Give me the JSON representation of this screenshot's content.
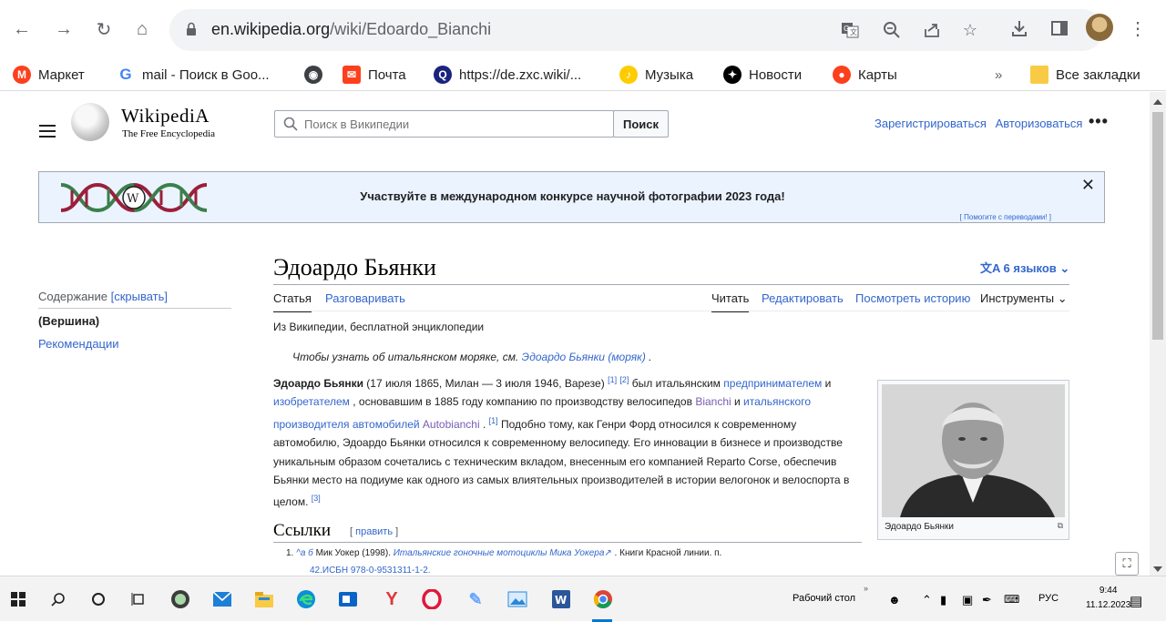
{
  "browser": {
    "url_domain": "en.wikipedia.org",
    "url_path": "/wiki/Edoardo_Bianchi"
  },
  "bookmarks": {
    "items": [
      {
        "label": "Маркет",
        "icon": "yandex-market-icon",
        "color": "#fc3f1d"
      },
      {
        "label": "mail - Поиск в Goo...",
        "icon": "google-icon",
        "color": "#4285f4"
      },
      {
        "label": "",
        "icon": "globe-icon",
        "color": "#3c4043"
      },
      {
        "label": "Почта",
        "icon": "mail-icon",
        "color": "#fc3f1d"
      },
      {
        "label": "https://de.zxc.wiki/...",
        "icon": "zxc-wiki-icon",
        "color": "#1a237e"
      },
      {
        "label": "Музыка",
        "icon": "music-icon",
        "color": "#ffcc00"
      },
      {
        "label": "Новости",
        "icon": "news-icon",
        "color": "#000000"
      },
      {
        "label": "Карты",
        "icon": "maps-icon",
        "color": "#fc3f1d"
      }
    ],
    "overflow": "»",
    "all_bookmarks": "Все закладки"
  },
  "wiki_header": {
    "wordmark": "WikipediA",
    "tagline": "The Free Encyclopedia",
    "search_placeholder": "Поиск в Википедии",
    "search_button": "Поиск",
    "register": "Зарегистрироваться",
    "login": "Авторизоваться",
    "more": "•••"
  },
  "banner": {
    "text": "Участвуйте в международном конкурсе научной фотографии 2023 года!",
    "help_link": "[ Помогите с переводами! ]",
    "close": "✕"
  },
  "toc": {
    "title": "Содержание",
    "toggle": "[скрывать]",
    "items": [
      "(Вершина)",
      "Рекомендации"
    ]
  },
  "article": {
    "title": "Эдоардо Бьянки",
    "languages": "6 языков",
    "tabs": {
      "article": "Статья",
      "talk": "Разговаривать",
      "read": "Читать",
      "edit": "Редактировать",
      "history": "Посмотреть историю",
      "tools": "Инструменты"
    },
    "from_wikipedia": "Из Википедии, бесплатной энциклопедии",
    "hatnote_prefix": "Чтобы узнать об итальянском моряке, см.",
    "hatnote_link": "Эдоардо Бьянки (моряк)",
    "hatnote_suffix": ".",
    "body": {
      "name_bold": "Эдоардо Бьянки",
      "t1": " (17 июля 1865, Милан — 3 июля 1946, Варезе) ",
      "sup1": "[1]",
      "sup2": "[2]",
      "t2": " был итальянским ",
      "link_entrepreneur": "предпринимателем",
      "t3": " и ",
      "link_inventor": "изобретателем",
      "t4": " , основавшим в 1885 году компанию по производству велосипедов ",
      "link_bianchi": "Bianchi",
      "t5": " и ",
      "link_italian": "итальянского производителя автомобилей",
      "t6": " ",
      "link_autobianchi": "Autobianchi",
      "t7": " . ",
      "sup3": "[1]",
      "t8": " Подобно тому, как Генри Форд относился к современному автомобилю, Эдоардо Бьянки относился к современному велосипеду. Его инновации в бизнесе и производстве уникальным образом сочетались с техническим вкладом, внесенным его компанией Reparto Corse, обеспечив Бьянки место на подиуме как одного из самых влиятельных производителей в истории велогонок и велоспорта в целом. ",
      "sup4": "[3]"
    },
    "infobox_caption": "Эдоардо Бьянки",
    "references_title": "Ссылки",
    "references_edit_open": "[",
    "references_edit": "править",
    "references_edit_close": "]",
    "ref1_num": "1.",
    "ref1_marks": "^а б",
    "ref1_author": "Мик Уокер (1998).",
    "ref1_title": "Итальянские гоночные мотоциклы Мика Уокера",
    "ref1_rest": " . Книги Красной линии. п.",
    "ref1_line2": "42.ИСБН 978-0-9531311-1-2."
  },
  "taskbar": {
    "desktop_label": "Рабочий стол",
    "lang": "РУС",
    "time": "9:44",
    "date": "11.12.2023"
  }
}
